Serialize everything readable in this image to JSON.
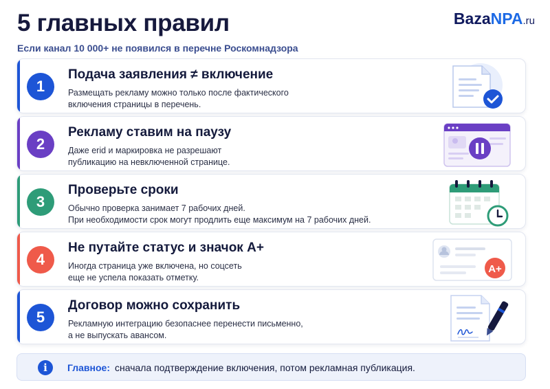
{
  "header": {
    "title": "5 главных правил",
    "subtitle": "Если канал 10 000+ не появился в перечне Роскомнадзора"
  },
  "logo": {
    "part1": "Baza",
    "part2": "NPA",
    "part3": ".ru"
  },
  "rules": [
    {
      "number": "1",
      "title": "Подача заявления ≠ включение",
      "line1": "Размещать рекламу можно только после фактического",
      "line2": "включения страницы в перечень.",
      "color": "#1d55d6",
      "icon": "document-check-icon"
    },
    {
      "number": "2",
      "title": "Рекламу ставим на паузу",
      "line1": "Даже erid и маркировка не разрешают",
      "line2": "публикацию на невключенной странице.",
      "color": "#6a3fc4",
      "icon": "pause-window-icon"
    },
    {
      "number": "3",
      "title": "Проверьте сроки",
      "line1": "Обычно проверка занимает 7 рабочих дней.",
      "line2": "При необходимости срок могут продлить еще максимум на 7 рабочих дней.",
      "color": "#2e9c78",
      "icon": "calendar-clock-icon"
    },
    {
      "number": "4",
      "title": "Не путайте статус и значок А+",
      "line1": "Иногда страница уже включена, но соцсеть",
      "line2": "еще не успела показать отметку.",
      "color": "#ef5a4a",
      "icon": "profile-badge-icon",
      "badge_text": "A+"
    },
    {
      "number": "5",
      "title": "Договор можно сохранить",
      "line1": "Рекламную интеграцию безопаснее перенести письменно,",
      "line2": "а не выпускать авансом.",
      "color": "#1d55d6",
      "icon": "contract-pen-icon"
    }
  ],
  "note": {
    "icon_text": "i",
    "lead": "Главное:",
    "text": "сначала подтверждение включения, потом рекламная публикация."
  }
}
